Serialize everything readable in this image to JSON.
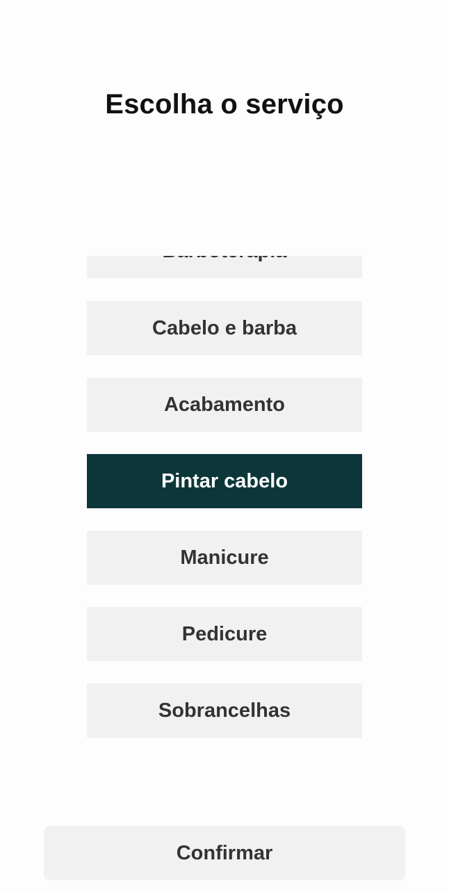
{
  "header": {
    "title": "Escolha o serviço"
  },
  "services": {
    "items": [
      {
        "label": "Barboterapia",
        "selected": false
      },
      {
        "label": "Cabelo e barba",
        "selected": false
      },
      {
        "label": "Acabamento",
        "selected": false
      },
      {
        "label": "Pintar cabelo",
        "selected": true
      },
      {
        "label": "Manicure",
        "selected": false
      },
      {
        "label": "Pedicure",
        "selected": false
      },
      {
        "label": "Sobrancelhas",
        "selected": false
      }
    ]
  },
  "footer": {
    "confirm_label": "Confirmar"
  },
  "colors": {
    "selected_bg": "#0c363a",
    "item_bg": "#f1f1f1",
    "text": "#333333"
  }
}
